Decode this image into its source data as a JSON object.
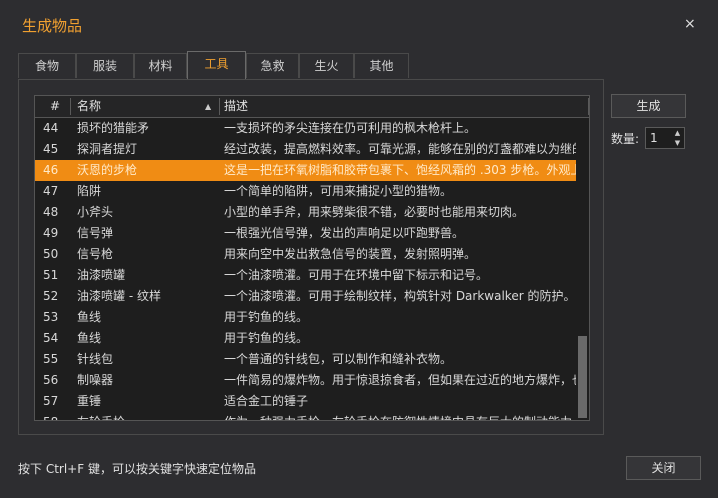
{
  "window": {
    "title": "生成物品",
    "close_glyph": "×"
  },
  "tabs": [
    "食物",
    "服装",
    "材料",
    "工具",
    "急救",
    "生火",
    "其他"
  ],
  "active_tab": "工具",
  "table": {
    "columns": {
      "num": "#",
      "name": "名称",
      "desc": "描述"
    },
    "sort_indicator": "▲",
    "rows": [
      {
        "num": "44",
        "name": "损坏的猎能矛",
        "desc": "一支损坏的矛尖连接在仍可利用的枫木枪杆上。"
      },
      {
        "num": "45",
        "name": "探洞者提灯",
        "desc": "经过改装，提高燃料效率。可靠光源，能够在别的灯盏都难以为继的环境"
      },
      {
        "num": "46",
        "name": "沃恩的步枪",
        "desc": "这是一把在环氧树脂和胶带包裹下、饱经风霜的 .303 步枪。外观上的"
      },
      {
        "num": "47",
        "name": "陷阱",
        "desc": "一个简单的陷阱，可用来捕捉小型的猎物。"
      },
      {
        "num": "48",
        "name": "小斧头",
        "desc": "小型的单手斧，用来劈柴很不错，必要时也能用来切肉。"
      },
      {
        "num": "49",
        "name": "信号弹",
        "desc": "一根强光信号弹，发出的声响足以吓跑野兽。"
      },
      {
        "num": "50",
        "name": "信号枪",
        "desc": "用来向空中发出救急信号的装置，发射照明弹。"
      },
      {
        "num": "51",
        "name": "油漆喷罐",
        "desc": "一个油漆喷灌。可用于在环境中留下标示和记号。"
      },
      {
        "num": "52",
        "name": "油漆喷罐 - 纹样",
        "desc": "一个油漆喷灌。可用于绘制纹样，构筑针对 Darkwalker 的防护。"
      },
      {
        "num": "53",
        "name": "鱼线",
        "desc": "用于钓鱼的线。"
      },
      {
        "num": "54",
        "name": "鱼线",
        "desc": "用于钓鱼的线。"
      },
      {
        "num": "55",
        "name": "针线包",
        "desc": "一个普通的针线包，可以制作和缝补衣物。"
      },
      {
        "num": "56",
        "name": "制噪器",
        "desc": "一件简易的爆炸物。用于惊退掠食者，但如果在过近的地方爆炸，也会"
      },
      {
        "num": "57",
        "name": "重锤",
        "desc": "适合金工的锤子"
      },
      {
        "num": "58",
        "name": "左轮手枪",
        "desc": "作为一种强力手枪，左轮手枪在防御性情境中具有巨大的制动能力。"
      }
    ],
    "selected_num": "46"
  },
  "side": {
    "generate_label": "生成",
    "quantity_label": "数量:",
    "quantity_value": "1",
    "up_glyph": "▲",
    "down_glyph": "▼"
  },
  "footer": {
    "hint": "按下 Ctrl+F 键，可以按关键字快速定位物品",
    "close_label": "关闭"
  },
  "colors": {
    "accent": "#f0a030",
    "selection": "#f08c14",
    "background": "#2d2d30"
  }
}
